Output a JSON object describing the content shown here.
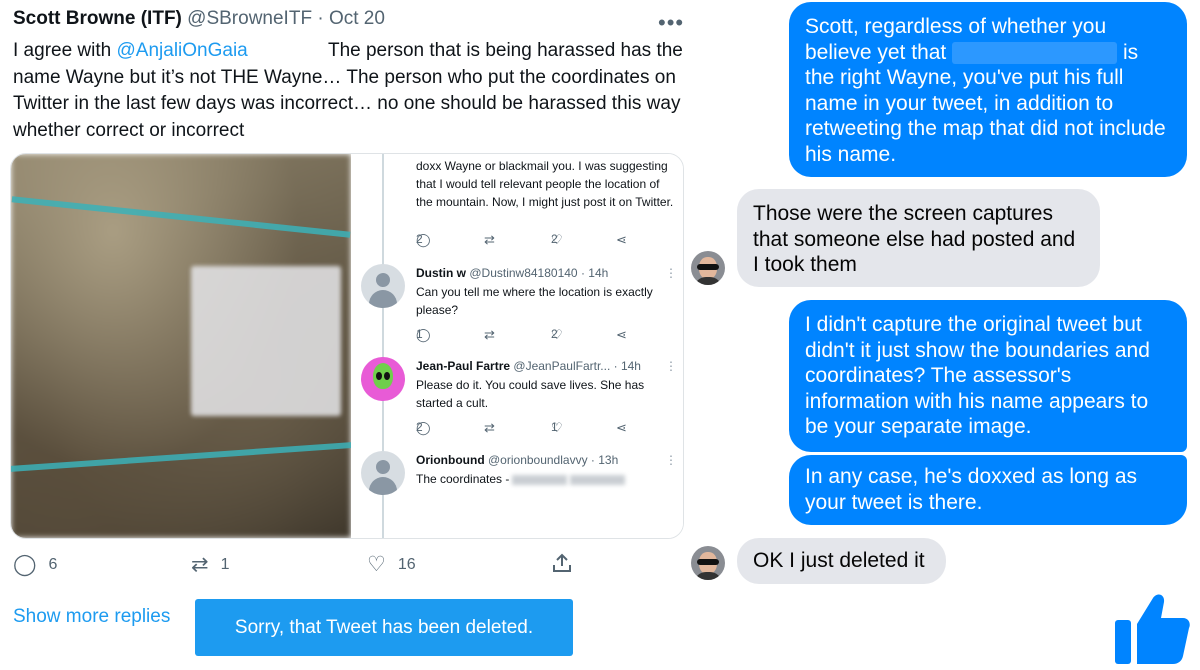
{
  "tweet": {
    "author_name": "Scott Browne (ITF)",
    "handle": "@SBrowneITF",
    "separator": "·",
    "date": "Oct 20",
    "more_icon": "more-horizontal-icon",
    "text_prefix": "I agree with ",
    "mention": "@AnjaliOnGaia",
    "text_body": "The person that is being harassed has the name Wayne but it’s not THE Wayne… The person who put the coordinates on Twitter in the last few days was incorrect… no one should be harassed this way whether correct or incorrect",
    "embedded_screenshot": {
      "top_text": "doxx Wayne or blackmail you. I was suggesting that I would tell relevant people the location of the mountain. Now, I might just post it on Twitter.",
      "top_counts": {
        "replies": "2",
        "likes": "2"
      },
      "replies": [
        {
          "name": "Dustin w",
          "handle": "@Dustinw84180140",
          "time": "· 14h",
          "text": "Can you tell me where the location is exactly please?",
          "replies": "1",
          "likes": "2"
        },
        {
          "name": "Jean-Paul Fartre",
          "handle": "@JeanPaulFartr...",
          "time": "· 14h",
          "text": "Please do it. You could save lives. She has started a cult.",
          "replies": "2",
          "likes": "1"
        },
        {
          "name": "Orionbound",
          "handle": "@orionboundlavvy",
          "time": "· 13h",
          "text": "The coordinates -"
        }
      ]
    },
    "actions": {
      "reply_icon": "reply-bubble-icon",
      "reply_count": "6",
      "retweet_icon": "retweet-icon",
      "retweet_count": "1",
      "like_icon": "heart-icon",
      "like_count": "16",
      "share_icon": "share-upload-icon"
    },
    "show_more_replies": "Show more replies",
    "deleted_notice": "Sorry, that Tweet has been deleted."
  },
  "messenger": {
    "messages": [
      {
        "direction": "out",
        "parts": [
          "Scott, regardless of whether you believe yet that",
          "is the right Wayne, you've put his full name in your tweet, in addition to retweeting the map that did not include his name."
        ]
      },
      {
        "direction": "in",
        "text": "Those were the screen captures that someone else had posted and I took them"
      },
      {
        "direction": "out",
        "text": "I didn't capture the original tweet but didn't it just show the boundaries and coordinates? The assessor's information with his name appears to be your separate image."
      },
      {
        "direction": "out",
        "text": "In any case, he's doxxed as long as your tweet is there."
      },
      {
        "direction": "in",
        "text": "OK I just deleted it"
      }
    ],
    "like_button_icon": "thumbs-up-icon",
    "colors": {
      "outgoing": "#0084ff",
      "incoming": "#e4e6eb",
      "twitter_blue": "#1d9bf0"
    }
  }
}
